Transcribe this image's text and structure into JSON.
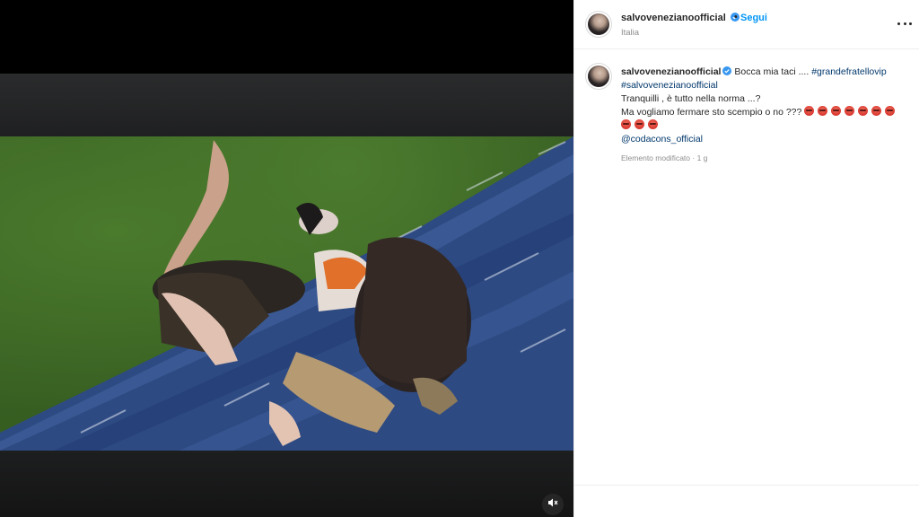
{
  "post": {
    "username": "salvovenezianoofficial",
    "follow_label": "Segui",
    "dot": "•",
    "location": "Italia",
    "caption": {
      "username": "salvovenezianoofficial",
      "lead": "Bocca mia taci ....",
      "hashtag1": "#grandefratellovip",
      "hashtag2": "#salvovenezianoofficial",
      "line2": "Tranquilli , è tutto nella norma ...?",
      "line3": "Ma vogliamo fermare sto scempio o no ???",
      "mention": "@codacons_official",
      "emoji_name": "face-with-symbols-on-mouth-emoji",
      "emoji_count": 10
    },
    "meta": "Elemento modificato · 1 g"
  },
  "media": {
    "mute_icon": "speaker-muted-icon"
  },
  "colors": {
    "link_blue": "#0095f6",
    "hashtag_blue": "#00376b",
    "verified_blue": "#3897f0",
    "muted_text": "#8e8e8e"
  }
}
